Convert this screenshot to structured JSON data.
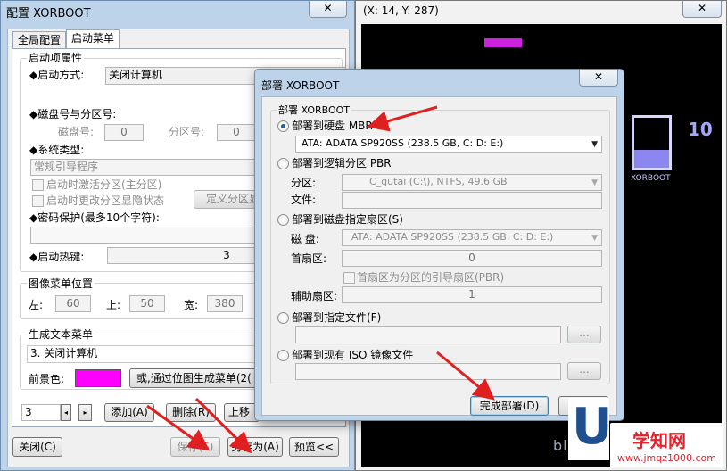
{
  "main_window": {
    "title": "配置 XORBOOT",
    "close": "✕",
    "tabs": [
      "全局配置",
      "启动菜单"
    ],
    "boot_props": {
      "title": "启动项属性",
      "boot_method_label": "◆启动方式:",
      "boot_method_value": "关闭计算机",
      "disk_part_label": "◆磁盘号与分区号:",
      "disk_label": "磁盘号:",
      "disk_value": "0",
      "part_label": "分区号:",
      "part_value": "0",
      "system_type_label": "◆系统类型:",
      "system_type_value": "常规引导程序",
      "cb_activate": "启动时激活分区(主分区)",
      "cb_hide": "启动时更改分区显隐状态",
      "define_btn": "定义分区显",
      "password_label": "◆密码保护(最多10个字符):",
      "hotkey_label": "◆启动热键:",
      "hotkey_value": "3"
    },
    "image_menu": {
      "title": "图像菜单位置",
      "left_label": "左:",
      "left_value": "60",
      "top_label": "上:",
      "top_value": "50",
      "width_label": "宽:",
      "width_value": "380"
    },
    "text_menu": {
      "title": "生成文本菜单",
      "item_text": "3. 关闭计算机",
      "fg_label": "前景色:",
      "fg_color": "#ff00ff",
      "gen_btn": "或,通过位图生成菜单(2("
    },
    "count_value": "3",
    "add_btn": "添加(A)",
    "delete_btn": "删除(R)",
    "up_btn": "上移",
    "close_btn": "关闭(C)",
    "save_btn": "保存(S)",
    "save_as_btn": "另存为(A)",
    "preview_btn": "预览<<"
  },
  "preview_window": {
    "coords": "(X: 14, Y: 287)",
    "close": "✕",
    "counter": "10",
    "logo_text": "XORBOOT"
  },
  "deploy_dialog": {
    "title": "部署 XORBOOT",
    "close": "✕",
    "group_title": "部署 XORBOOT",
    "opt_mbr": "部署到硬盘 MBR",
    "mbr_disk": "ATA: ADATA SP920SS (238.5 GB, C: D: E:)",
    "opt_pbr": "部署到逻辑分区 PBR",
    "partition_label": "分区:",
    "partition_value": "C_gutai (C:\\),  NTFS,  49.6 GB",
    "file_label": "文件:",
    "opt_sector": "部署到磁盘指定扇区(S)",
    "disk_label": "磁  盘:",
    "sector_disk": "ATA: ADATA SP920SS (238.5 GB, C: D: E:)",
    "first_sector_label": "首扇区:",
    "first_sector_value": "0",
    "cb_pbr": "首扇区为分区的引导扇区(PBR)",
    "aux_sector_label": "辅助扇区:",
    "aux_sector_value": "1",
    "opt_file": "部署到指定文件(F)",
    "opt_iso": "部署到现有 ISO 镜像文件",
    "browse": "...",
    "finish_btn": "完成部署(D)",
    "cancel_btn": "取消"
  },
  "watermark": {
    "blog": "blog",
    "main": "学知网",
    "site": "www.jmqz1000.com"
  },
  "colors": {
    "arrow": "#e02020",
    "title_bar": "#bcd3ea",
    "preview_bg": "#000000"
  }
}
